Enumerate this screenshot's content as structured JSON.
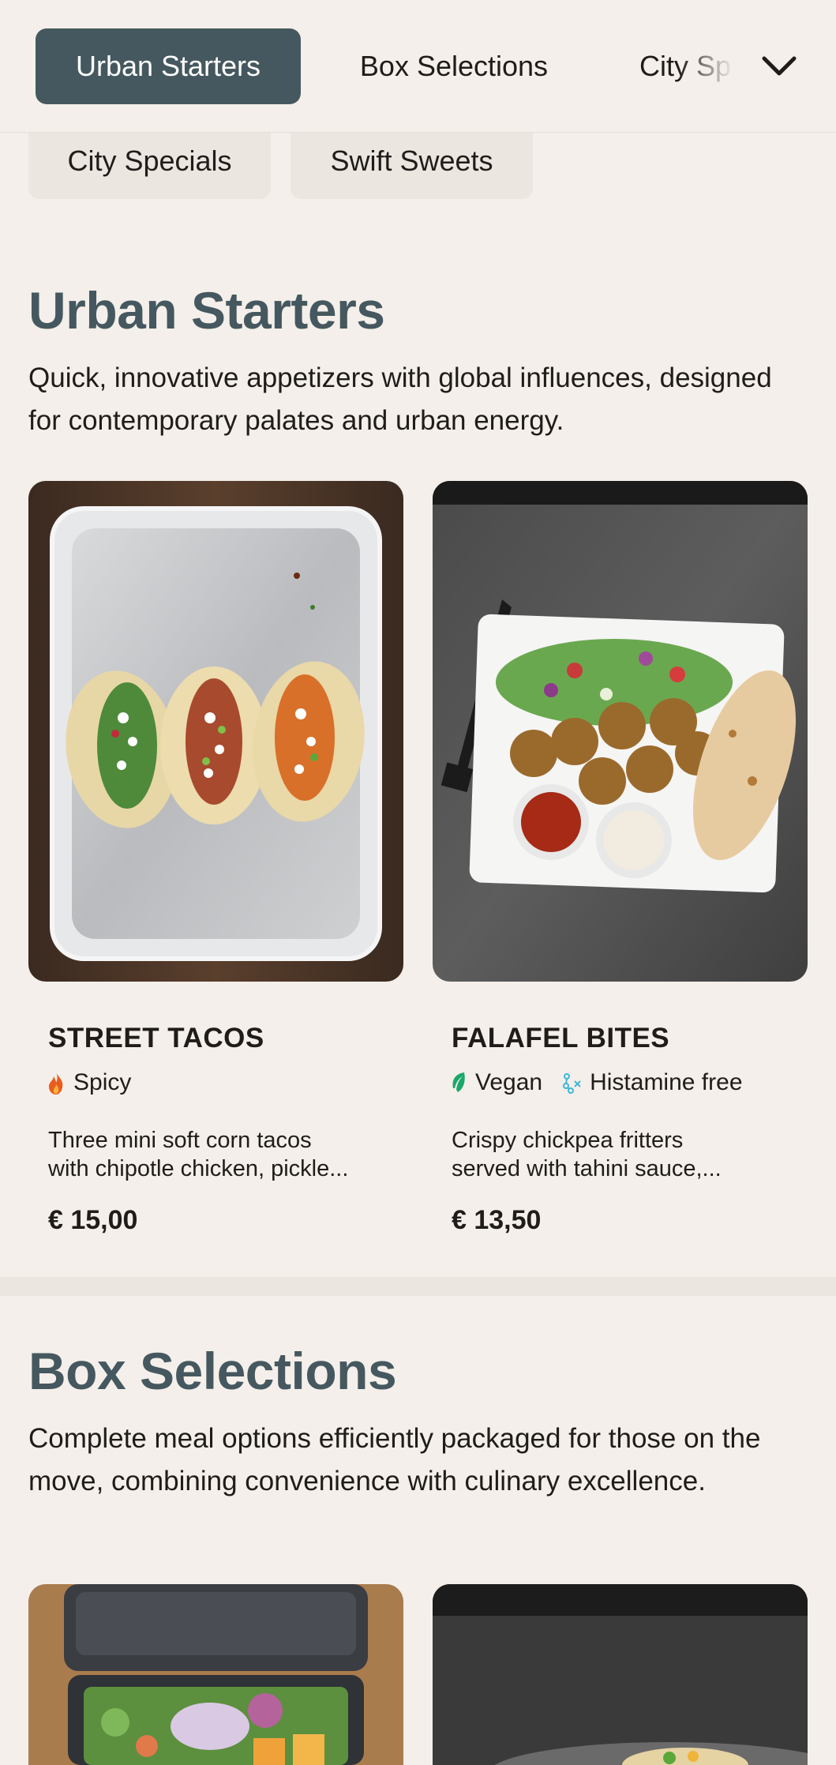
{
  "nav": {
    "tabs": [
      {
        "label": "Urban Starters",
        "active": true
      },
      {
        "label": "Box Selections",
        "active": false
      },
      {
        "label": "City Specials",
        "active": false
      }
    ],
    "truncated_tab_visible_label": "City Sp",
    "overflow_chips": [
      {
        "label": "City Specials"
      },
      {
        "label": "Swift Sweets"
      }
    ],
    "dropdown_icon": "chevron-down-icon"
  },
  "sections": [
    {
      "title": "Urban Starters",
      "description": "Quick, innovative appetizers with global influences, designed for contemporary palates and urban energy.",
      "items": [
        {
          "name": "STREET TACOS",
          "tags": [
            {
              "label": "Spicy",
              "icon": "flame-icon",
              "color": "#e85d1f"
            }
          ],
          "description_line1": "Three mini soft corn tacos",
          "description_line2": "with chipotle chicken, pickle...",
          "price": "€ 15,00"
        },
        {
          "name": "FALAFEL BITES",
          "tags": [
            {
              "label": "Vegan",
              "icon": "leaf-icon",
              "color": "#1aa86a"
            },
            {
              "label": "Histamine free",
              "icon": "histamine-free-icon",
              "color": "#3db6d8"
            }
          ],
          "description_line1": "Crispy chickpea fritters",
          "description_line2": "served with tahini sauce,...",
          "price": "€ 13,50"
        }
      ]
    },
    {
      "title": "Box Selections",
      "description": "Complete meal options efficiently packaged for those on the move, combining convenience with culinary excellence."
    }
  ],
  "colors": {
    "background": "#f4efea",
    "accent": "#46585f",
    "chip": "#ece6e0",
    "text": "#1f1c1a"
  }
}
